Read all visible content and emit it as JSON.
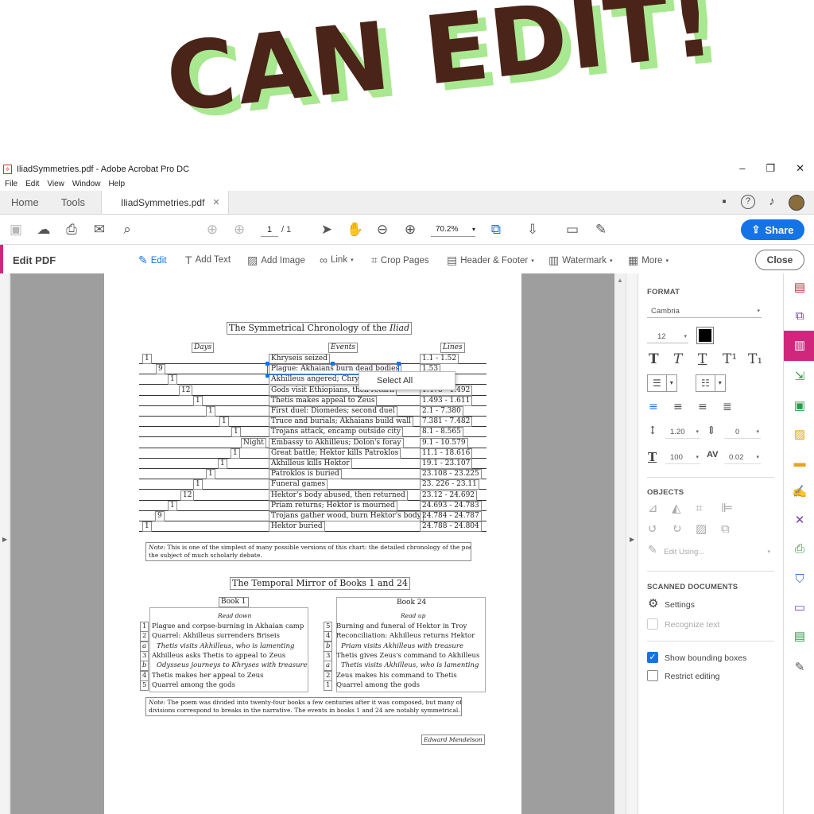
{
  "banner": {
    "text": "CAN EDIT!"
  },
  "window": {
    "title": "IliadSymmetries.pdf - Adobe Acrobat Pro DC",
    "controls": [
      "–",
      "❐",
      "✕"
    ],
    "menu": [
      "File",
      "Edit",
      "View",
      "Window",
      "Help"
    ]
  },
  "tabs": {
    "home": "Home",
    "tools": "Tools",
    "doc": "IliadSymmetries.pdf",
    "doc_close": "✕"
  },
  "toolbar": {
    "page_current": "1",
    "page_total": "/ 1",
    "zoom": "70.2%",
    "share_label": "Share"
  },
  "editbar": {
    "title": "Edit PDF",
    "items": [
      "Edit",
      "Add Text",
      "Add Image",
      "Link",
      "Crop Pages",
      "Header & Footer",
      "Watermark",
      "More"
    ],
    "close_label": "Close"
  },
  "document": {
    "title1_pre": "The Symmetrical Chronology of the ",
    "title1_em": "Iliad",
    "col_days": "Days",
    "col_events": "Events",
    "col_lines": "Lines",
    "rows": [
      {
        "day": "1",
        "event": "Khryseis seized",
        "lines": "1.1 - 1.52"
      },
      {
        "day": "9",
        "event": "Plague: Akhaians burn dead bodies",
        "lines": "1.53"
      },
      {
        "day": "1",
        "event": "Akhilleus angered; Chryseis",
        "lines": ""
      },
      {
        "day": "12",
        "event": "Gods visit Ethiopians, then return",
        "lines": "1.478 - 1.492"
      },
      {
        "day": "1",
        "event": "Thetis makes appeal to Zeus",
        "lines": "1.493 - 1.611"
      },
      {
        "day": "1",
        "event": "First duel: Diomedes; second duel",
        "lines": "2.1 - 7.380"
      },
      {
        "day": "1",
        "event": "Truce and burials; Akhaians build wall",
        "lines": "7.381 - 7.482"
      },
      {
        "day": "1",
        "event": "Trojans attack, encamp outside city",
        "lines": "8.1 - 8.565"
      },
      {
        "day": "Night",
        "event": "Embassy to Akhilleus; Dolon's foray",
        "lines": "9.1 - 10.579"
      },
      {
        "day": "1",
        "event": "Great battle; Hektor kills Patroklos",
        "lines": "11.1 - 18.616"
      },
      {
        "day": "1",
        "event": "Akhilleus kills Hektor",
        "lines": "19.1 - 23.107"
      },
      {
        "day": "1",
        "event": "Patroklos is buried",
        "lines": "23.108 - 23.225"
      },
      {
        "day": "1",
        "event": "Funeral games",
        "lines": "23. 226 - 23.11"
      },
      {
        "day": "12",
        "event": "Hektor's body abused, then returned",
        "lines": "23.12 - 24.692"
      },
      {
        "day": "1",
        "event": "Priam returns; Hektor is mourned",
        "lines": "24.693 - 24.783"
      },
      {
        "day": "9",
        "event": "Trojans gather wood, burn Hektor's body",
        "lines": "24.784 - 24.787"
      },
      {
        "day": "1",
        "event": "Hektor buried",
        "lines": "24.788 - 24.804"
      }
    ],
    "note1_label": "Note:",
    "note1_line1": " This is one of the simplest of many possible versions of this chart: the detailed chronology of the poem is",
    "note1_line2": "the subject of much scholarly debate.",
    "title2": "The Temporal Mirror of Books 1 and 24",
    "book1": {
      "title": "Book 1",
      "sub": "Read down",
      "items": [
        {
          "n": "1",
          "t": "Plague and corpse-burning in Akhaian camp",
          "i": false
        },
        {
          "n": "2",
          "t": "Quarrel: Akhilleus surrenders Briseis",
          "i": false
        },
        {
          "n": "a",
          "t": "Thetis visits Akhilleus, who is lamenting",
          "i": true
        },
        {
          "n": "3",
          "t": "Akhilleus asks Thetis to appeal to Zeus",
          "i": false
        },
        {
          "n": "b",
          "t": "Odysseus journeys to Khryses with treasure",
          "i": true
        },
        {
          "n": "4",
          "t": "Thetis makes her appeal to Zeus",
          "i": false
        },
        {
          "n": "5",
          "t": "Quarrel among the gods",
          "i": false
        }
      ]
    },
    "book24": {
      "title": "Book 24",
      "sub": "Read up",
      "items": [
        {
          "n": "5",
          "t": "Burning and funeral of Hektor in Troy",
          "i": false
        },
        {
          "n": "4",
          "t": "Reconciliation: Akhilleus returns Hektor",
          "i": false
        },
        {
          "n": "b",
          "t": "Priam visits Akhilleus with treasure",
          "i": true
        },
        {
          "n": "3",
          "t": "Thetis gives Zeus's command to Akhilleus",
          "i": false
        },
        {
          "n": "a",
          "t": "Thetis visits Akhilleus, who is lamenting",
          "i": true
        },
        {
          "n": "2",
          "t": "Zeus makes his command to Thetis",
          "i": false
        },
        {
          "n": "1",
          "t": "Quarrel among the gods",
          "i": false
        }
      ]
    },
    "note2_label": "Note:",
    "note2_line1": " The poem was divided into twenty-four books a few centuries after it was composed, but many of the",
    "note2_line2": "divisions correspond to breaks in the narrative. The events in books 1 and 24 are notably symmetrical.",
    "author": "Edward Mendelson",
    "context_menu": "Select All"
  },
  "panel": {
    "format_heading": "FORMAT",
    "font": "Cambria",
    "font_size": "12",
    "text_color": "#000000",
    "line_spacing": "1.20",
    "para_spacing": "0",
    "h_scale": "100",
    "char_spacing": "0.02",
    "objects_heading": "OBJECTS",
    "edit_using": "Edit Using...",
    "scanned_heading": "SCANNED DOCUMENTS",
    "settings": "Settings",
    "recognize": "Recognize text",
    "show_bounding": "Show bounding boxes",
    "restrict": "Restrict editing"
  },
  "colors": {
    "accent": "#1473e6",
    "brand": "#d0277d",
    "banner_text": "#4a2418",
    "banner_shadow": "#a8e890"
  }
}
